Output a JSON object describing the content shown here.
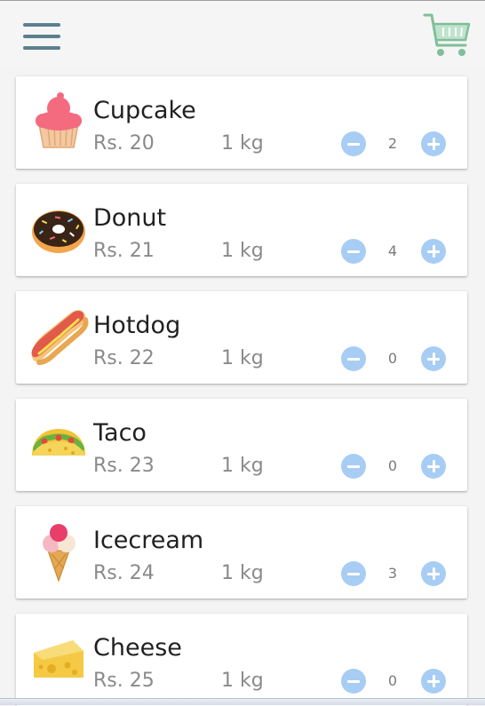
{
  "appbar": {
    "menu_icon": "hamburger-menu-icon",
    "cart_icon": "shopping-cart-icon",
    "colors": {
      "menu": "#5b7f8e",
      "cart": "#7fbf9a"
    }
  },
  "products": [
    {
      "name": "Cupcake",
      "price": "Rs. 20",
      "weight": "1 kg",
      "quantity": "2",
      "icon": "cupcake-icon"
    },
    {
      "name": "Donut",
      "price": "Rs. 21",
      "weight": "1 kg",
      "quantity": "4",
      "icon": "donut-icon"
    },
    {
      "name": "Hotdog",
      "price": "Rs. 22",
      "weight": "1 kg",
      "quantity": "0",
      "icon": "hotdog-icon"
    },
    {
      "name": "Taco",
      "price": "Rs. 23",
      "weight": "1 kg",
      "quantity": "0",
      "icon": "taco-icon"
    },
    {
      "name": "Icecream",
      "price": "Rs. 24",
      "weight": "1 kg",
      "quantity": "3",
      "icon": "icecream-icon"
    },
    {
      "name": "Cheese",
      "price": "Rs. 25",
      "weight": "1 kg",
      "quantity": "0",
      "icon": "cheese-icon"
    }
  ],
  "colors": {
    "stepper_button": "#a8cdf4",
    "name_text": "#212121",
    "secondary_text": "#8a8a8a"
  }
}
